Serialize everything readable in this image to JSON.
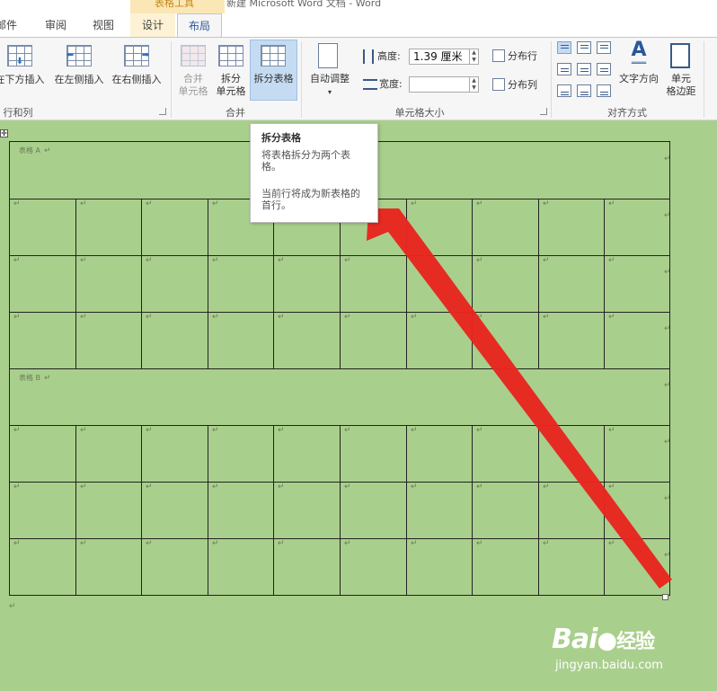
{
  "window": {
    "title": "新建 Microsoft Word 文档 - Word",
    "context_label": "表格工具"
  },
  "tabs": [
    {
      "label": "邮件"
    },
    {
      "label": "审阅"
    },
    {
      "label": "视图"
    },
    {
      "label": "设计"
    },
    {
      "label": "布局"
    }
  ],
  "ribbon": {
    "rows_cols": {
      "insert_below": "在下方插入",
      "insert_left": "在左侧插入",
      "insert_right": "在右侧插入",
      "group_label": "行和列"
    },
    "merge": {
      "merge_cells": [
        "合并",
        "单元格"
      ],
      "split_cells": [
        "拆分",
        "单元格"
      ],
      "split_table": "拆分表格",
      "group_label": "合并"
    },
    "cell_size": {
      "autofit": "自动调整",
      "height_label": "高度:",
      "height_value": "1.39 厘米",
      "width_label": "宽度:",
      "width_value": "",
      "distribute_rows": "分布行",
      "distribute_cols": "分布列",
      "group_label": "单元格大小"
    },
    "alignment": {
      "text_direction": "文字方向",
      "cell_margins": [
        "单元",
        "格边距"
      ],
      "group_label": "对齐方式"
    }
  },
  "tooltip": {
    "title": "拆分表格",
    "desc_lines": [
      "将表格拆分为两个表",
      "格。"
    ],
    "note_lines": [
      "当前行将成为新表格的",
      "首行。"
    ]
  },
  "document": {
    "table_a": {
      "heading": "表格 A",
      "rows": 3,
      "cols": 10
    },
    "table_b": {
      "heading": "表格 B",
      "rows": 3,
      "cols": 10
    },
    "para_mark": "↵"
  },
  "watermark": {
    "brand_left": "Bai",
    "brand_right": "经验",
    "url": "jingyan.baidu.com"
  },
  "colors": {
    "doc_background": "#a9cf8c",
    "ribbon_selected": "#c5dbf2",
    "arrow": "#e8251f",
    "context_tab": "#fdf2d5"
  }
}
